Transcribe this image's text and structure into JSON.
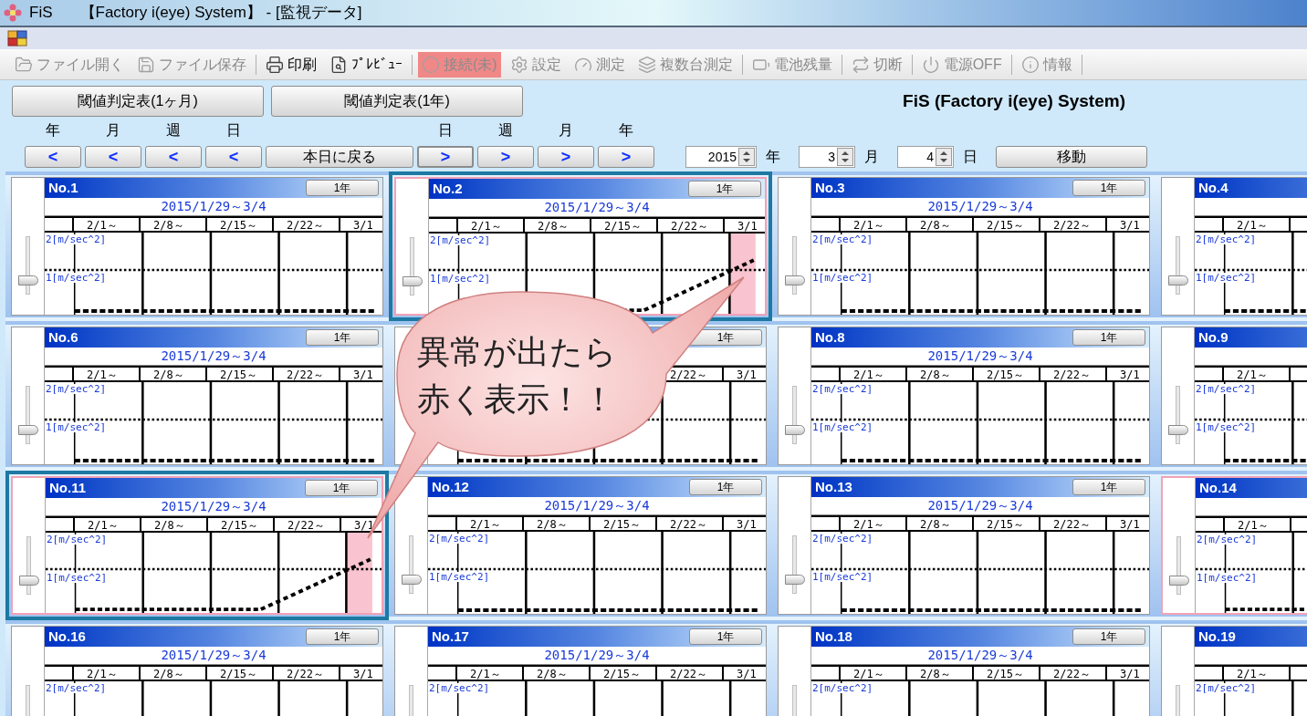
{
  "window": {
    "app_name": "FiS",
    "title": "【Factory i(eye) System】 - [監視データ]"
  },
  "toolbar": [
    {
      "label": "ファイル開く",
      "disabled": true,
      "alert": false,
      "separator_after": false
    },
    {
      "label": "ファイル保存",
      "disabled": true,
      "alert": false,
      "separator_after": true
    },
    {
      "label": "印刷",
      "disabled": false,
      "alert": false,
      "separator_after": false
    },
    {
      "label": "ﾌﾟﾚﾋﾞｭｰ",
      "disabled": false,
      "alert": false,
      "separator_after": true
    },
    {
      "label": "接続(未)",
      "disabled": true,
      "alert": true,
      "separator_after": false
    },
    {
      "label": "設定",
      "disabled": true,
      "alert": false,
      "separator_after": false
    },
    {
      "label": "測定",
      "disabled": true,
      "alert": false,
      "separator_after": false
    },
    {
      "label": "複数台測定",
      "disabled": true,
      "alert": false,
      "separator_after": true
    },
    {
      "label": "電池残量",
      "disabled": true,
      "alert": false,
      "separator_after": true
    },
    {
      "label": "切断",
      "disabled": true,
      "alert": false,
      "separator_after": true
    },
    {
      "label": "電源OFF",
      "disabled": true,
      "alert": false,
      "separator_after": true
    },
    {
      "label": "情報",
      "disabled": true,
      "alert": false,
      "separator_after": true
    }
  ],
  "report_buttons": [
    "閾値判定表(1ヶ月)",
    "閾値判定表(1年)"
  ],
  "heading": "FiS (Factory i(eye) System)",
  "back_buttons": [
    {
      "caption": "年",
      "symbol": "<",
      "focused": false
    },
    {
      "caption": "月",
      "symbol": "<",
      "focused": false
    },
    {
      "caption": "週",
      "symbol": "<",
      "focused": false
    },
    {
      "caption": "日",
      "symbol": "<",
      "focused": false
    }
  ],
  "today_button": "本日に戻る",
  "forward_buttons": [
    {
      "caption": "日",
      "symbol": ">",
      "focused": true
    },
    {
      "caption": "週",
      "symbol": ">",
      "focused": false
    },
    {
      "caption": "月",
      "symbol": ">",
      "focused": false
    },
    {
      "caption": "年",
      "symbol": ">",
      "focused": false
    }
  ],
  "date_fields": [
    {
      "value": "2015",
      "unit": "年"
    },
    {
      "value": "3",
      "unit": "月"
    },
    {
      "value": "4",
      "unit": "日"
    }
  ],
  "move_button": "移動",
  "panels": [
    {
      "kind": "normal",
      "number": "No.1",
      "range_button": "1年",
      "date_range": "2015/1/29～3/4",
      "weeks": [
        "2/1～",
        "2/8～",
        "2/15～",
        "2/22～",
        "3/1"
      ],
      "axis_labels": [
        "2[m/sec^2]",
        "1[m/sec^2]"
      ],
      "level": 0.25,
      "alarm": false,
      "highlighted": false
    },
    {
      "kind": "normal",
      "number": "No.2",
      "range_button": "1年",
      "date_range": "2015/1/29～3/4",
      "weeks": [
        "2/1～",
        "2/8～",
        "2/15～",
        "2/22～",
        "3/1"
      ],
      "axis_labels": [
        "2[m/sec^2]",
        "1[m/sec^2]"
      ],
      "level": 0.25,
      "alarm": true,
      "highlighted": true
    },
    {
      "kind": "normal",
      "number": "No.3",
      "range_button": "1年",
      "date_range": "2015/1/29～3/4",
      "weeks": [
        "2/1～",
        "2/8～",
        "2/15～",
        "2/22～",
        "3/1"
      ],
      "axis_labels": [
        "2[m/sec^2]",
        "1[m/sec^2]"
      ],
      "level": 0.25,
      "alarm": false,
      "highlighted": false
    },
    {
      "kind": "edge",
      "number": "No.4",
      "weeks": [
        "2/1～"
      ],
      "axis_labels": [
        "2[m/sec^2]",
        "1[m/sec^2]"
      ],
      "level": 0.25,
      "alarm": false,
      "highlighted": false
    },
    {
      "kind": "normal",
      "number": "No.6",
      "range_button": "1年",
      "date_range": "2015/1/29～3/4",
      "weeks": [
        "2/1～",
        "2/8～",
        "2/15～",
        "2/22～",
        "3/1"
      ],
      "axis_labels": [
        "2[m/sec^2]",
        "1[m/sec^2]"
      ],
      "level": 0.25,
      "alarm": false,
      "highlighted": false
    },
    {
      "kind": "covered",
      "range_button": "1年",
      "weeks": [
        "2/22～",
        "3/1"
      ],
      "alarm": false,
      "highlighted": false
    },
    {
      "kind": "normal",
      "number": "No.8",
      "range_button": "1年",
      "date_range": "2015/1/29～3/4",
      "weeks": [
        "2/1～",
        "2/8～",
        "2/15～",
        "2/22～",
        "3/1"
      ],
      "axis_labels": [
        "2[m/sec^2]",
        "1[m/sec^2]"
      ],
      "level": 0.25,
      "alarm": false,
      "highlighted": false
    },
    {
      "kind": "edge",
      "number": "No.9",
      "weeks": [
        "2/1～"
      ],
      "axis_labels": [
        "2[m/sec^2]",
        "1[m/sec^2]"
      ],
      "level": 0.25,
      "alarm": false,
      "highlighted": false
    },
    {
      "kind": "normal",
      "number": "No.11",
      "range_button": "1年",
      "date_range": "2015/1/29～3/4",
      "weeks": [
        "2/1～",
        "2/8～",
        "2/15～",
        "2/22～",
        "3/1"
      ],
      "axis_labels": [
        "2[m/sec^2]",
        "1[m/sec^2]"
      ],
      "level": 0.25,
      "alarm": true,
      "highlighted": true
    },
    {
      "kind": "normal",
      "number": "No.12",
      "range_button": "1年",
      "date_range": "2015/1/29～3/4",
      "weeks": [
        "2/1～",
        "2/8～",
        "2/15～",
        "2/22～",
        "3/1"
      ],
      "axis_labels": [
        "2[m/sec^2]",
        "1[m/sec^2]"
      ],
      "level": 0.25,
      "alarm": false,
      "highlighted": false
    },
    {
      "kind": "normal",
      "number": "No.13",
      "range_button": "1年",
      "date_range": "2015/1/29～3/4",
      "weeks": [
        "2/1～",
        "2/8～",
        "2/15～",
        "2/22～",
        "3/1"
      ],
      "axis_labels": [
        "2[m/sec^2]",
        "1[m/sec^2]"
      ],
      "level": 0.25,
      "alarm": false,
      "highlighted": false
    },
    {
      "kind": "edge",
      "number": "No.14",
      "weeks": [
        "2/1～"
      ],
      "axis_labels": [
        "2[m/sec^2]",
        "1[m/sec^2]"
      ],
      "level": 0.25,
      "alarm": true,
      "highlighted": false
    },
    {
      "kind": "normal",
      "number": "No.16",
      "range_button": "1年",
      "date_range": "2015/1/29～3/4",
      "weeks": [
        "2/1～",
        "2/8～",
        "2/15～",
        "2/22～",
        "3/1"
      ],
      "axis_labels": [
        "2[m/sec^2]"
      ],
      "alarm": false,
      "highlighted": false
    },
    {
      "kind": "normal",
      "number": "No.17",
      "range_button": "1年",
      "date_range": "2015/1/29～3/4",
      "weeks": [
        "2/1～",
        "2/8～",
        "2/15～",
        "2/22～",
        "3/1"
      ],
      "axis_labels": [
        "2[m/sec^2]"
      ],
      "alarm": false,
      "highlighted": false
    },
    {
      "kind": "normal",
      "number": "No.18",
      "range_button": "1年",
      "date_range": "2015/1/29～3/4",
      "weeks": [
        "2/1～",
        "2/8～",
        "2/15～",
        "2/22～",
        "3/1"
      ],
      "axis_labels": [
        "2[m/sec^2]"
      ],
      "alarm": false,
      "highlighted": false
    },
    {
      "kind": "edge",
      "number": "No.19",
      "weeks": [
        "2/1～"
      ],
      "axis_labels": [
        "2[m/sec^2]"
      ],
      "alarm": false,
      "highlighted": false
    }
  ],
  "callout": {
    "lines": [
      "異常が出たら",
      "赤く表示！！"
    ]
  }
}
